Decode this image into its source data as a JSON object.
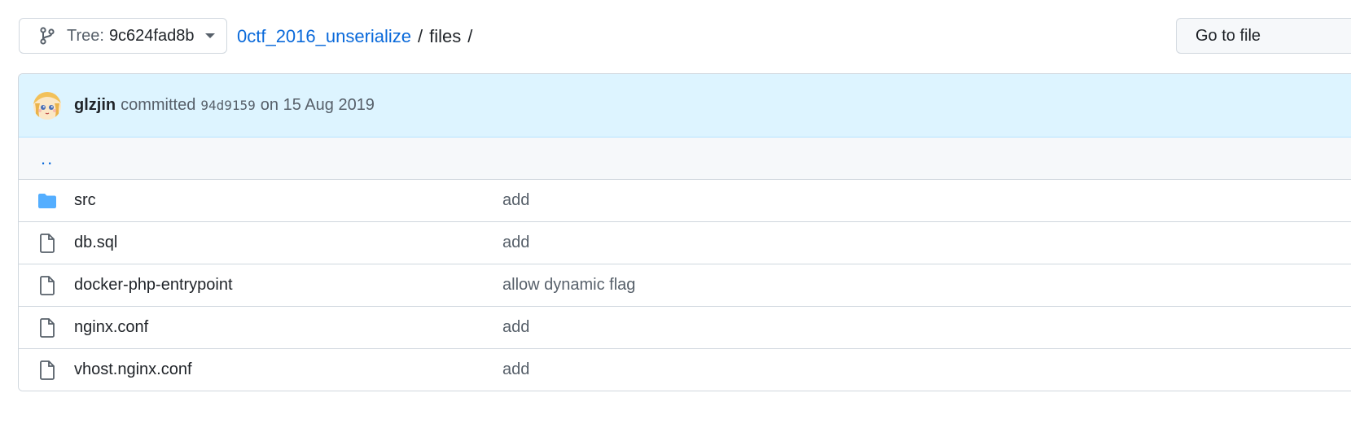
{
  "toolbar": {
    "tree_prefix": "Tree:",
    "tree_sha": "9c624fad8b",
    "goto_label": "Go to file"
  },
  "breadcrumb": {
    "repo": "0ctf_2016_unserialize",
    "separator": "/",
    "current": "files",
    "trailing": "/"
  },
  "commit": {
    "author": "glzjin",
    "verb": "committed",
    "sha": "94d9159",
    "date": "on 15 Aug 2019"
  },
  "parent_link": "..",
  "files": [
    {
      "name": "src",
      "message": "add",
      "type": "folder"
    },
    {
      "name": "db.sql",
      "message": "add",
      "type": "file"
    },
    {
      "name": "docker-php-entrypoint",
      "message": "allow dynamic flag",
      "type": "file"
    },
    {
      "name": "nginx.conf",
      "message": "add",
      "type": "file"
    },
    {
      "name": "vhost.nginx.conf",
      "message": "add",
      "type": "file"
    }
  ],
  "colors": {
    "link": "#0969da",
    "folder": "#54aeff",
    "commit_bg": "#ddf4ff"
  }
}
